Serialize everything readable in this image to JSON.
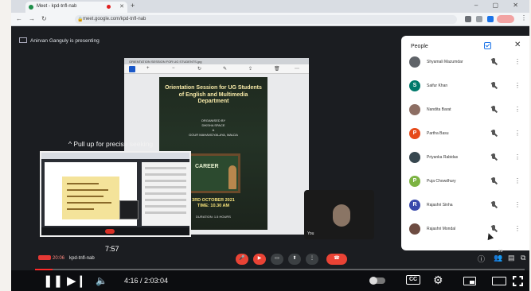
{
  "browser": {
    "tab_title": "Meet - kpd-tnfl-nab",
    "url": "meet.google.com/kpd-tnfl-nab",
    "new_tab": "+",
    "window_controls": "– ▢ ✕"
  },
  "meet": {
    "presenting_banner": "Anirvan Ganguly is presenting",
    "pull_up_hint": "Pull up for precise seeking",
    "thumbnail_time": "7:57",
    "meeting_clock": "20:06",
    "meeting_code": "kpd-tnfl-nab",
    "participant_count": "29",
    "camera_label": "You"
  },
  "shared_screen": {
    "file_bar": "ORIENTATION SESSION FOR UG STUDENTS.jpg",
    "poster": {
      "title": "Orientation Session for UG Students of English and Multimedia Department",
      "organisers": "ORGANISED BY\nDIKSHA SPACE\n&\nGOUR MAHAVIDYALAYA, MALDA",
      "board_text": "CAREER",
      "date_time": "3RD OCTOBER 2021\nTIME: 10.30 AM",
      "duration": "DURATION: 1.5 HOURS"
    }
  },
  "people_panel": {
    "title": "People",
    "close_icon": "✕",
    "participants": [
      {
        "name": "Shyamali Mazumdar",
        "initial": "",
        "color": "#5f6368"
      },
      {
        "name": "Saifur Khan",
        "initial": "S",
        "color": "#00796b"
      },
      {
        "name": "Nandita Barat",
        "initial": "",
        "color": "#8d6e63"
      },
      {
        "name": "Partha Basu",
        "initial": "P",
        "color": "#e64a19"
      },
      {
        "name": "Priyanka Rabidas",
        "initial": "",
        "color": "#37474f"
      },
      {
        "name": "Puja Chowdhury",
        "initial": "P",
        "color": "#7cb342"
      },
      {
        "name": "Rajashri Sinha",
        "initial": "R",
        "color": "#3949ab"
      },
      {
        "name": "Rajashri Mondal",
        "initial": "",
        "color": "#6d4c41"
      }
    ]
  },
  "player": {
    "current_time": "4:16",
    "duration": "2:03:04",
    "time_display": "4:16 / 2:03:04",
    "progress_fraction": 0.035,
    "cc_label": "CC",
    "accent": "#ff2a2a"
  }
}
